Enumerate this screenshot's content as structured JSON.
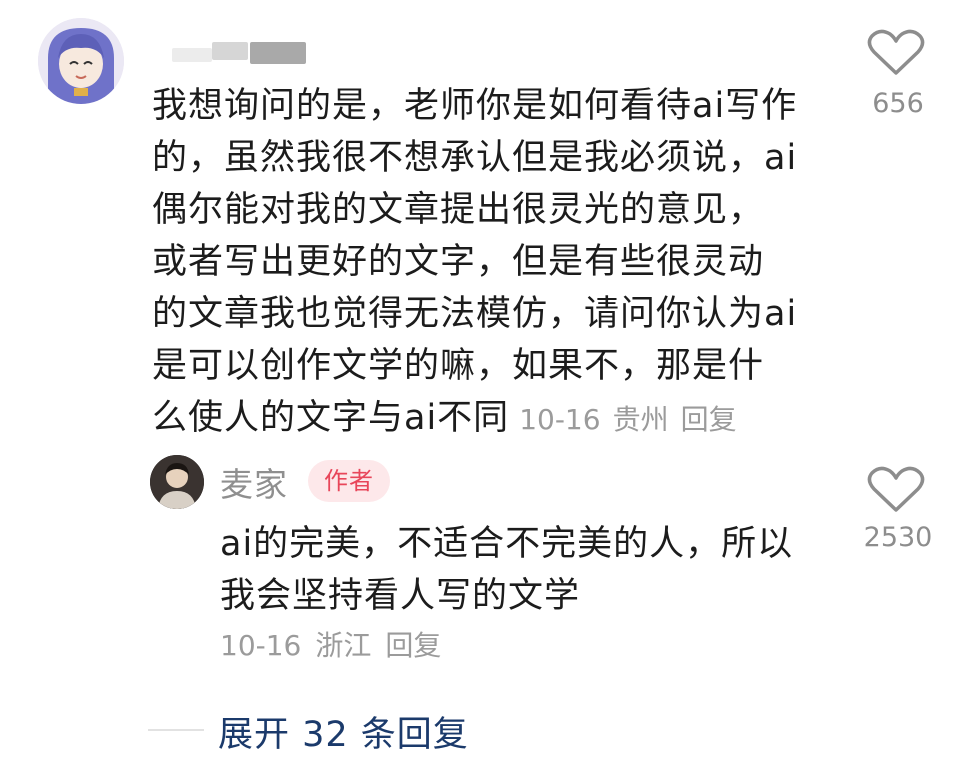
{
  "comment": {
    "lines": [
      "我想询问的是，老师你是如何看待ai写作",
      "的，虽然我很不想承认但是我必须说，ai",
      "偶尔能对我的文章提出很灵光的意见，",
      "或者写出更好的文字，但是有些很灵动",
      "的文章我也觉得无法模仿，请问你认为ai",
      "是可以创作文学的嘛，如果不，那是什",
      "么使人的文字与ai不同"
    ],
    "date": "10-16",
    "location": "贵州",
    "reply_label": "回复",
    "like_count": "656"
  },
  "reply": {
    "author_name": "麦家",
    "author_badge": "作者",
    "lines": [
      "ai的完美，不适合不完美的人，所以",
      "我会坚持看人写的文学"
    ],
    "date": "10-16",
    "location": "浙江",
    "reply_label": "回复",
    "like_count": "2530"
  },
  "expand": {
    "label": "展开 32 条回复"
  },
  "icons": {
    "like": "heart-outline-icon"
  },
  "colors": {
    "text": "#1c1c1c",
    "meta": "#9b9b9b",
    "author_badge_bg": "#fde8ea",
    "author_badge_text": "#e8465a",
    "expand_link": "#1b3a6b"
  }
}
